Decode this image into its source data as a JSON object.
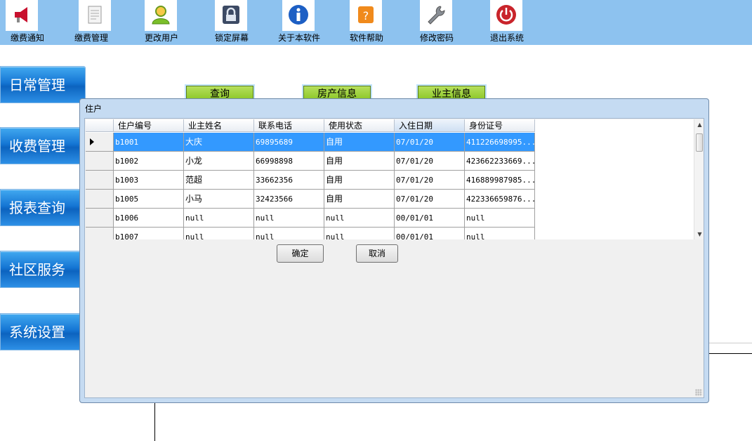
{
  "toolbar": {
    "items": [
      {
        "label": "缴费通知",
        "icon": "megaphone-icon"
      },
      {
        "label": "缴费管理",
        "icon": "document-icon"
      },
      {
        "label": "更改用户",
        "icon": "user-icon"
      },
      {
        "label": "锁定屏幕",
        "icon": "lock-icon"
      },
      {
        "label": "关于本软件",
        "icon": "info-icon"
      },
      {
        "label": "软件帮助",
        "icon": "help-icon"
      },
      {
        "label": "修改密码",
        "icon": "wrench-icon"
      },
      {
        "label": "退出系统",
        "icon": "power-icon"
      }
    ]
  },
  "nav": {
    "items": [
      "日常管理",
      "收费管理",
      "报表查询",
      "社区服务",
      "系统设置"
    ]
  },
  "query_buttons": [
    "查询",
    "房产信息",
    "业主信息"
  ],
  "dialog": {
    "title": "住户",
    "columns": [
      "住户编号",
      "业主姓名",
      "联系电话",
      "使用状态",
      "入住日期",
      "身份证号"
    ],
    "rows": [
      [
        "b1001",
        "大庆",
        "69895689",
        "自用",
        "07/01/20",
        "411226698995..."
      ],
      [
        "b1002",
        "小龙",
        "66998898",
        "自用",
        "07/01/20",
        "423662233669..."
      ],
      [
        "b1003",
        "范超",
        "33662356",
        "自用",
        "07/01/20",
        "416889987985..."
      ],
      [
        "b1005",
        "小马",
        "32423566",
        "自用",
        "07/01/20",
        "422336659876..."
      ],
      [
        "b1006",
        "null",
        "null",
        "null",
        "00/01/01",
        "null"
      ],
      [
        "b1007",
        "null",
        "null",
        "null",
        "00/01/01",
        "null"
      ]
    ],
    "selected_row_index": 0,
    "confirm_label": "确定",
    "cancel_label": "取消"
  },
  "colors": {
    "toolbar_bg": "#8dc2ef",
    "nav_blue": "#1576d4",
    "selection": "#3399ff",
    "query_green": "#9acd32"
  }
}
